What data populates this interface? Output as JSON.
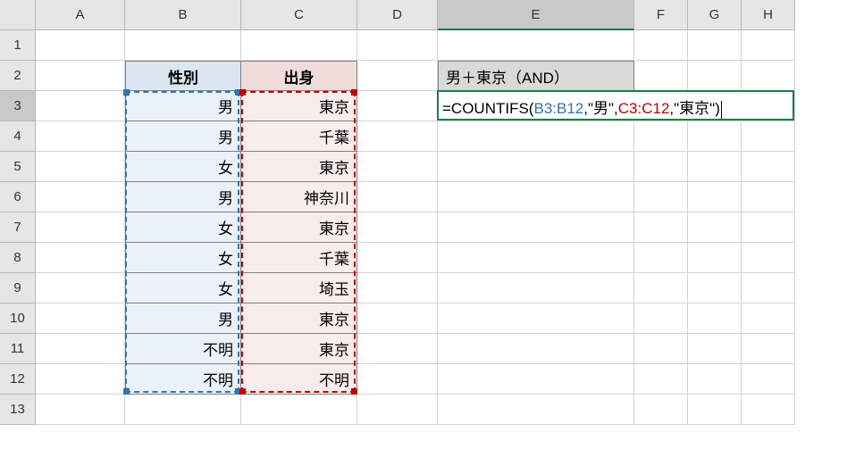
{
  "cols": [
    "A",
    "B",
    "C",
    "D",
    "E",
    "F",
    "G",
    "H"
  ],
  "rows": [
    "1",
    "2",
    "3",
    "4",
    "5",
    "6",
    "7",
    "8",
    "9",
    "10",
    "11",
    "12",
    "13"
  ],
  "headers": {
    "b": "性別",
    "c": "出身"
  },
  "e2_label": "男＋東京（AND）",
  "formula": {
    "prefix": "=COUNTIFS(",
    "ref1": "B3:B12",
    "sep1": ",\"男\",",
    "ref2": "C3:C12",
    "suffix": ",\"東京\")"
  },
  "data": [
    {
      "b": "男",
      "c": "東京"
    },
    {
      "b": "男",
      "c": "千葉"
    },
    {
      "b": "女",
      "c": "東京"
    },
    {
      "b": "男",
      "c": "神奈川"
    },
    {
      "b": "女",
      "c": "東京"
    },
    {
      "b": "女",
      "c": "千葉"
    },
    {
      "b": "女",
      "c": "埼玉"
    },
    {
      "b": "男",
      "c": "東京"
    },
    {
      "b": "不明",
      "c": "東京"
    },
    {
      "b": "不明",
      "c": "不明"
    }
  ],
  "chart_data": {
    "type": "table",
    "columns": [
      "性別",
      "出身"
    ],
    "rows": [
      [
        "男",
        "東京"
      ],
      [
        "男",
        "千葉"
      ],
      [
        "女",
        "東京"
      ],
      [
        "男",
        "神奈川"
      ],
      [
        "女",
        "東京"
      ],
      [
        "女",
        "千葉"
      ],
      [
        "女",
        "埼玉"
      ],
      [
        "男",
        "東京"
      ],
      [
        "不明",
        "東京"
      ],
      [
        "不明",
        "不明"
      ]
    ]
  }
}
